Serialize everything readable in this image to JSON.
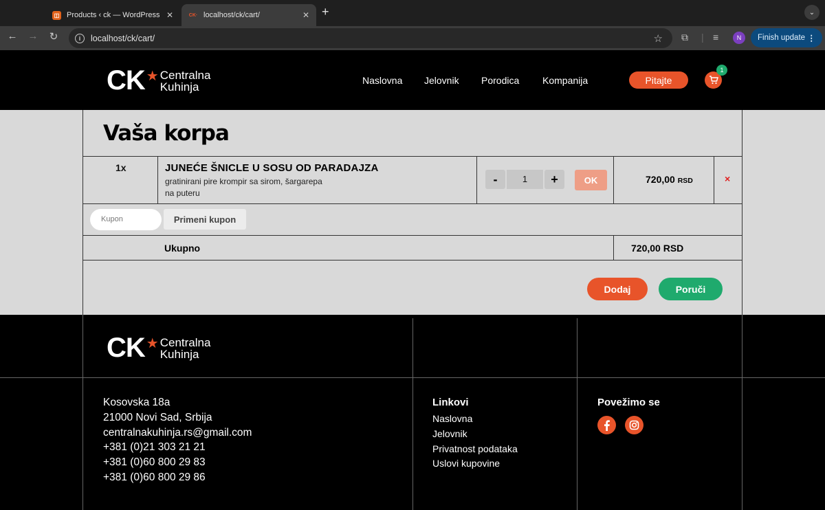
{
  "browser": {
    "tabs": [
      {
        "title": "Products ‹ ck — WordPress",
        "favicon": "wordpress-icon"
      },
      {
        "title": "localhost/ck/cart/",
        "favicon": "ck-icon",
        "favicon_text": "CK·"
      }
    ],
    "url": "localhost/ck/cart/",
    "profile_initial": "N",
    "finish_update_label": "Finish update"
  },
  "header": {
    "logo": {
      "mark": "CK",
      "name_line1": "Centralna",
      "name_line2": "Kuhinja"
    },
    "nav": [
      "Naslovna",
      "Jelovnik",
      "Porodica",
      "Kompanija"
    ],
    "cta_label": "Pitajte",
    "cart_count": "1"
  },
  "cart": {
    "title": "Vaša korpa",
    "items": [
      {
        "qty_label": "1x",
        "name": "JUNEĆE ŠNICLE U SOSU OD PARADAJZA",
        "desc_line1": "gratinirani pire krompir sa sirom, šargarepa",
        "desc_line2": "na puteru",
        "quantity": "1",
        "minus_label": "-",
        "plus_label": "+",
        "ok_label": "OK",
        "price_amount": "720,00",
        "price_currency": "RSD",
        "remove_label": "×"
      }
    ],
    "coupon_placeholder": "Kupon",
    "coupon_button": "Primeni kupon",
    "total_label": "Ukupno",
    "total_value": "720,00 RSD",
    "add_label": "Dodaj",
    "order_label": "Poruči"
  },
  "footer": {
    "logo": {
      "mark": "CK",
      "name_line1": "Centralna",
      "name_line2": "Kuhinja"
    },
    "address_lines": [
      "Kosovska 18a",
      "21000 Novi Sad, Srbija",
      "centralnakuhinja.rs@gmail.com",
      "+381 (0)21 303 21 21",
      "+381 (0)60 800 29 83",
      "+381 (0)60 800 29 86"
    ],
    "links_title": "Linkovi",
    "links": [
      "Naslovna",
      "Jelovnik",
      "Privatnost podataka",
      "Uslovi kupovine"
    ],
    "social_title": "Povežimo se",
    "social": [
      "facebook-icon",
      "instagram-icon"
    ]
  },
  "colors": {
    "accent": "#e8542a",
    "green": "#1faa6d",
    "cart_bg": "#d9d9d9"
  }
}
